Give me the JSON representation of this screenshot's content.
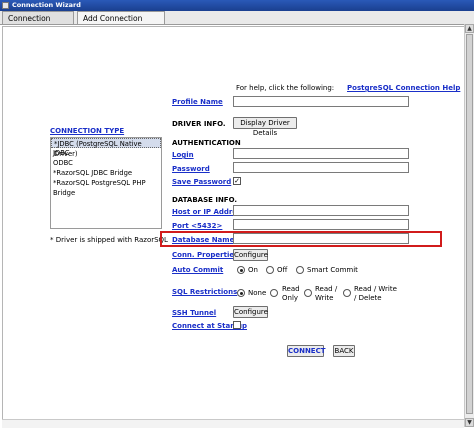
{
  "window": {
    "title": "Connection Wizard"
  },
  "tabs": [
    {
      "label": "Connection Profiles",
      "active": false
    },
    {
      "label": "Add Connection Profile",
      "active": true
    }
  ],
  "help": {
    "prefix": "For help, click the following:",
    "link": "PostgreSQL Connection Help"
  },
  "profile": {
    "label": "Profile Name",
    "value": ""
  },
  "driver_info": {
    "label": "DRIVER INFO.",
    "button": "Display Driver Details"
  },
  "connection_type": {
    "label": "CONNECTION TYPE",
    "items": [
      "*JDBC (PostgreSQL Native Driver)",
      "JDBC",
      "ODBC",
      "*RazorSQL JDBC Bridge",
      "*RazorSQL PostgreSQL PHP Bridge"
    ],
    "selected_index": 0,
    "note": "* Driver is shipped with RazorSQL"
  },
  "authentication": {
    "label": "AUTHENTICATION",
    "login_label": "Login",
    "login_value": "",
    "password_label": "Password",
    "password_value": "",
    "save_password_label": "Save Password",
    "save_password_checked": true
  },
  "database_info": {
    "label": "DATABASE INFO.",
    "host_label": "Host or IP Address",
    "host_value": "",
    "port_label": "Port <5432>",
    "port_value": "",
    "dbname_label": "Database Name",
    "dbname_value": "",
    "conn_props_label": "Conn. Properties",
    "conn_props_button": "Configure"
  },
  "auto_commit": {
    "label": "Auto Commit",
    "options": [
      "On",
      "Off",
      "Smart Commit"
    ],
    "selected": "On"
  },
  "sql_restrictions": {
    "label": "SQL Restrictions",
    "options": [
      "None",
      "Read Only",
      "Read / Write",
      "Read / Write / Delete"
    ],
    "option_lines": [
      [
        "None"
      ],
      [
        "Read",
        "Only"
      ],
      [
        "Read /",
        "Write"
      ],
      [
        "Read / Write",
        "/ Delete"
      ]
    ],
    "selected": "None"
  },
  "ssh_tunnel": {
    "label": "SSH Tunnel",
    "button": "Configure"
  },
  "connect_at_startup": {
    "label": "Connect at Startup",
    "checked": false
  },
  "actions": {
    "connect": "CONNECT",
    "back": "BACK"
  },
  "colors": {
    "link": "#1a2fc8",
    "highlight": "#d11b1b",
    "titlebar": "#2a59b8"
  }
}
